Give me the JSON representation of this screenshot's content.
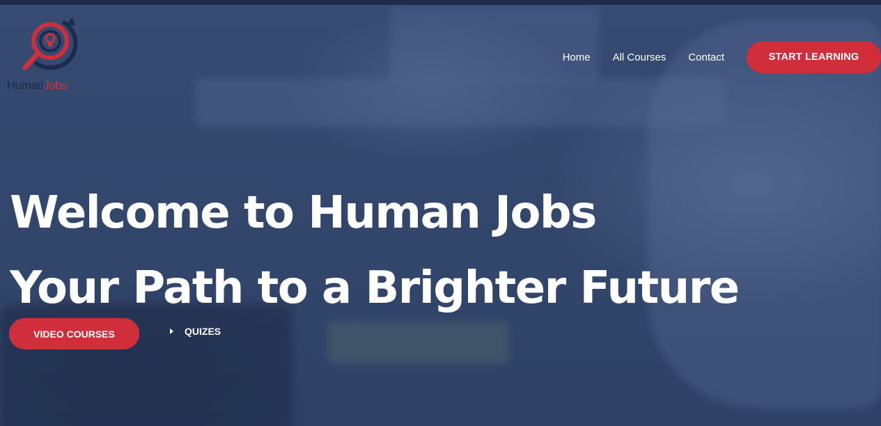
{
  "brand": {
    "name_part1": "Human",
    "name_part2": "Jobs",
    "colors": {
      "primary_red": "#d02e3a",
      "navy": "#1c2b4a",
      "overlay": "#33476d"
    }
  },
  "nav": {
    "links": [
      "Home",
      "All Courses",
      "Contact"
    ],
    "cta_label": "START LEARNING"
  },
  "hero": {
    "title_line1": "Welcome to Human Jobs",
    "title_line2": "Your Path to a Brighter Future",
    "primary_button": "VIDEO COURSES",
    "secondary_link": "QUIZES"
  }
}
